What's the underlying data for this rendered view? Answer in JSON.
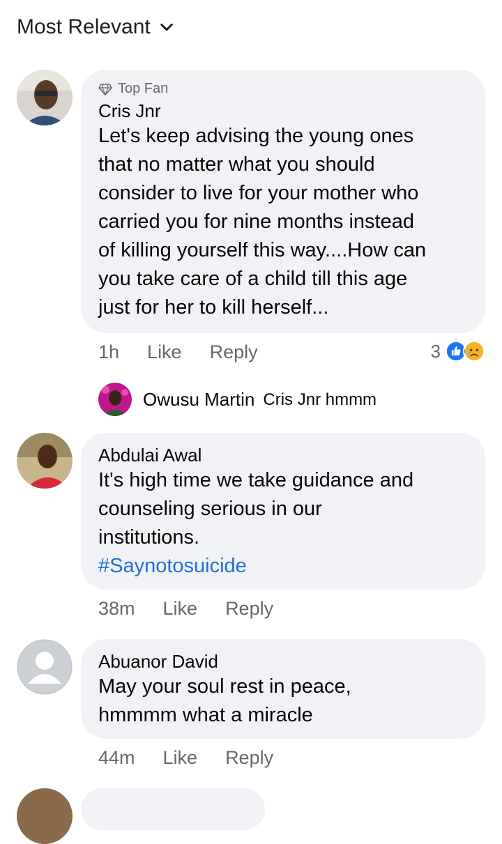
{
  "sort": {
    "label": "Most Relevant"
  },
  "comments": [
    {
      "badge": "Top Fan",
      "author": "Cris Jnr",
      "lines": [
        "Let's keep advising the young ones",
        "that no matter what you should",
        "consider to live for your mother who",
        "carried you for nine months instead",
        "of killing yourself this way....How can",
        "you take care of a child till this age",
        "just for her to kill herself..."
      ],
      "time": "1h",
      "like": "Like",
      "reply": "Reply",
      "reaction_count": "3",
      "reaction_icons": [
        "like-icon",
        "sad-icon"
      ],
      "replies": [
        {
          "author": "Owusu Martin",
          "text": "Cris Jnr hmmm"
        }
      ]
    },
    {
      "author": "Abdulai Awal",
      "lines": [
        "It's high time we take guidance and",
        "counseling serious in our",
        "institutions."
      ],
      "hashtag": "#Saynotosuicide",
      "time": "38m",
      "like": "Like",
      "reply": "Reply"
    },
    {
      "author": "Abuanor David",
      "lines": [
        "May your soul rest in peace,",
        "hmmmm what a miracle"
      ],
      "time": "44m",
      "like": "Like",
      "reply": "Reply"
    }
  ],
  "colors": {
    "bubble": "#f0f2f5",
    "meta": "#65676b",
    "hashtag": "#216fdb",
    "like_blue": "#1877f2",
    "sad_yellow": "#f7b125"
  }
}
